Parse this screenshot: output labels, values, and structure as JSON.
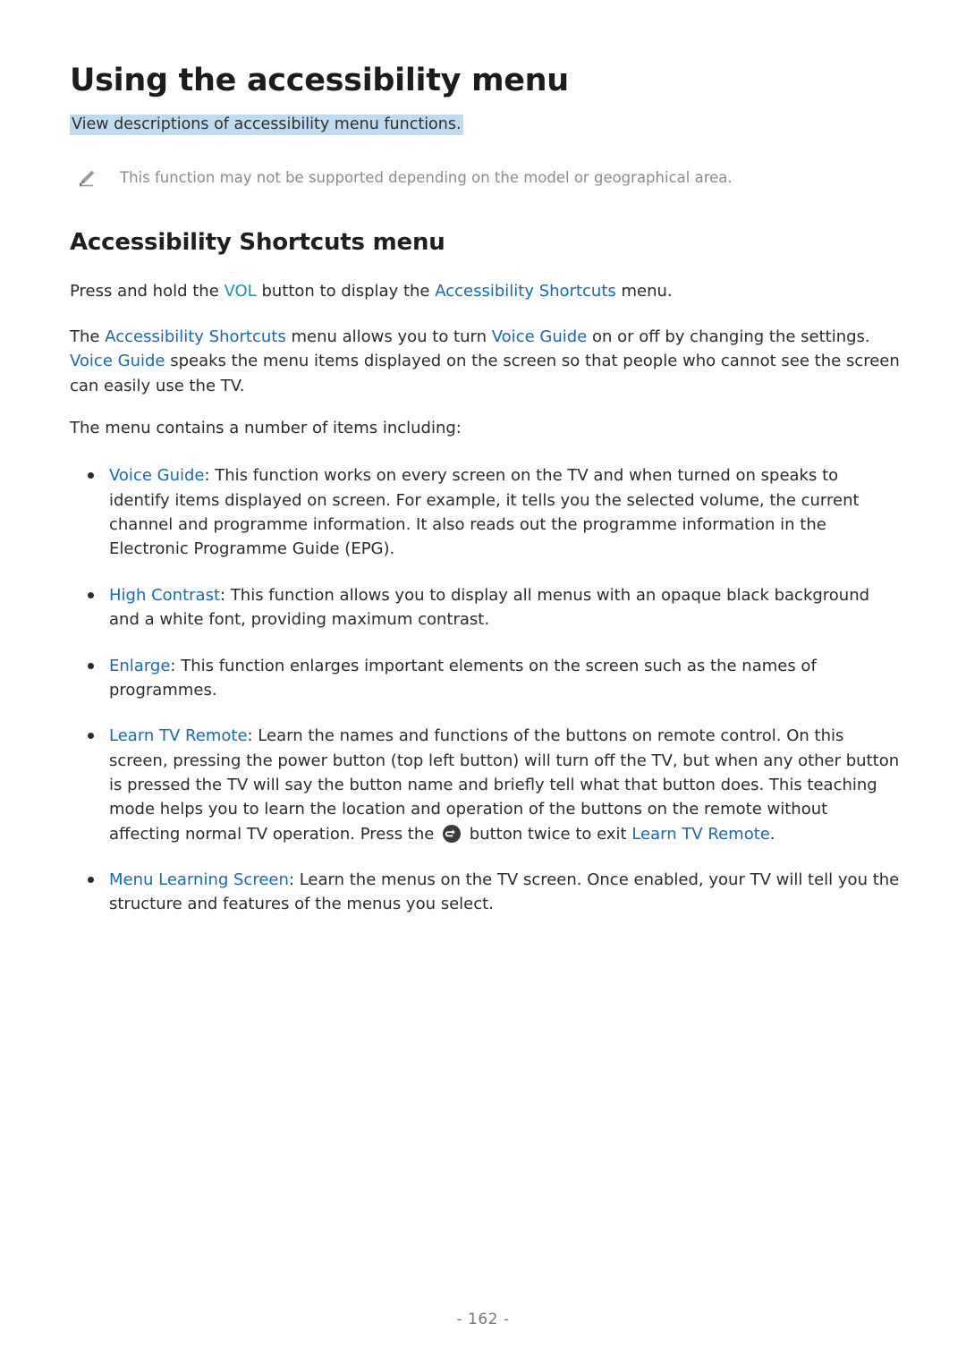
{
  "page": {
    "title": "Using the accessibility menu",
    "subtitle": "View descriptions of accessibility menu functions.",
    "footer_page_number": "- 162 -"
  },
  "note": {
    "icon": "pencil-icon",
    "text": "This function may not be supported depending on the model or geographical area."
  },
  "section": {
    "heading": "Accessibility Shortcuts menu",
    "paragraph_1": {
      "part_1": "Press and hold the ",
      "link_vol": "VOL",
      "part_2": " button to display the ",
      "link_shortcuts": "Accessibility Shortcuts",
      "part_3": " menu."
    },
    "paragraph_2": {
      "part_1": "The ",
      "link_shortcuts": "Accessibility Shortcuts",
      "part_2": " menu allows you to turn ",
      "link_voice_guide_1": "Voice Guide",
      "part_3": " on or off by changing the settings. ",
      "link_voice_guide_2": "Voice Guide",
      "part_4": " speaks the menu items displayed on the screen so that people who cannot see the screen can easily use the TV."
    },
    "paragraph_3": "The menu contains a number of items including:"
  },
  "bullets": [
    {
      "term": "Voice Guide",
      "body": ": This function works on every screen on the TV and when turned on speaks to identify items displayed on screen. For example, it tells you the selected volume, the current channel and programme information. It also reads out the programme information in the Electronic Programme Guide (EPG)."
    },
    {
      "term": "High Contrast",
      "body": ": This function allows you to display all menus with an opaque black background and a white font, providing maximum contrast."
    },
    {
      "term": "Enlarge",
      "body": ": This function enlarges important elements on the screen such as the names of programmes."
    },
    {
      "term": "Learn TV Remote",
      "body_before_icon": ": Learn the names and functions of the buttons on remote control. On this screen, pressing the power button (top left button) will turn off the TV, but when any other button is pressed the TV will say the button name and briefly tell what that button does. This teaching mode helps you to learn the location and operation of the buttons on the remote without affecting normal TV operation. Press the ",
      "icon": "return-button-icon",
      "body_after_icon": " button twice to exit ",
      "trailing_link": "Learn TV Remote",
      "body_end": "."
    },
    {
      "term": "Menu Learning Screen",
      "body": ": Learn the menus on the TV screen. Once enabled, your TV will tell you the structure and features of the menus you select."
    }
  ],
  "colors": {
    "link_blue": "#1667c0",
    "link_teal": "#1896a5",
    "highlight": "#bfdcef",
    "body_text": "#2b2b2b",
    "note_text": "#8c8c8c"
  }
}
